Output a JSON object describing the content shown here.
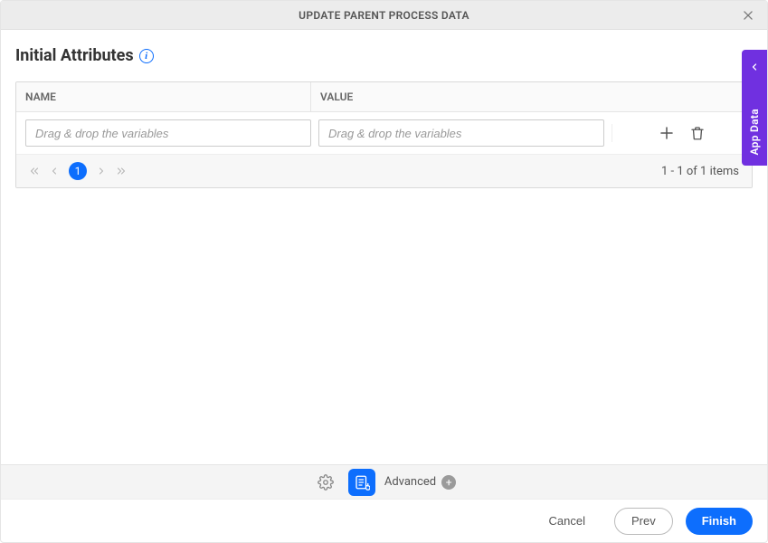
{
  "header": {
    "title": "UPDATE PARENT PROCESS DATA"
  },
  "section": {
    "title": "Initial Attributes"
  },
  "table": {
    "name_header": "NAME",
    "value_header": "VALUE",
    "rows": [
      {
        "name_placeholder": "Drag & drop the variables",
        "value_placeholder": "Drag & drop the variables"
      }
    ]
  },
  "pager": {
    "current": "1",
    "status": "1 - 1 of 1 items"
  },
  "side_tab": {
    "label": "App Data"
  },
  "toolbar": {
    "advanced_label": "Advanced"
  },
  "footer": {
    "cancel": "Cancel",
    "prev": "Prev",
    "finish": "Finish"
  }
}
